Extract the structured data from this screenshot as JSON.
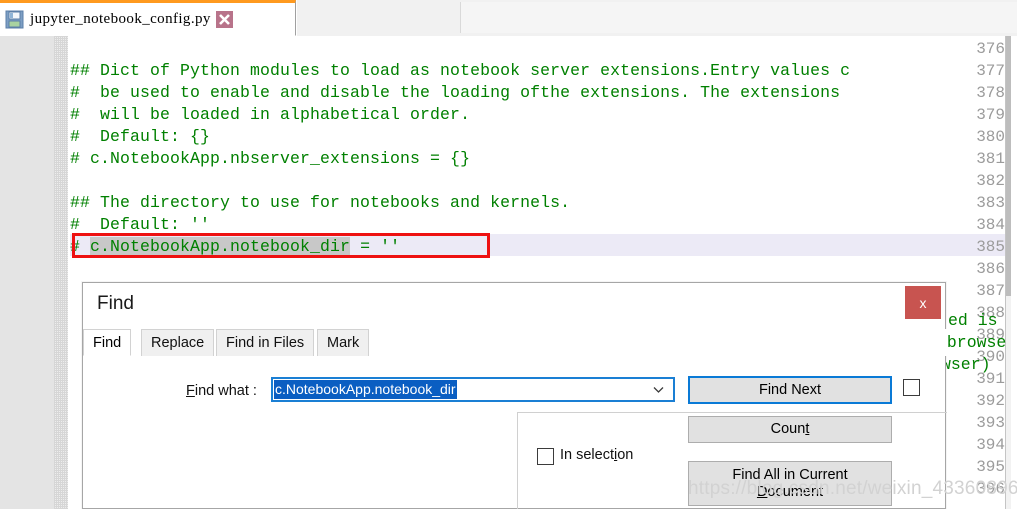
{
  "window": {
    "tab": {
      "title": "jupyter_notebook_config.py",
      "save_icon": "floppy-save-icon",
      "close_icon": "close-x-icon"
    }
  },
  "editor": {
    "first_line_number": 376,
    "current_line_number": 385,
    "lines": [
      {
        "no": "376",
        "text": ""
      },
      {
        "no": "377",
        "text": "## Dict of Python modules to load as notebook server extensions.Entry values c"
      },
      {
        "no": "378",
        "text": "#  be used to enable and disable the loading ofthe extensions. The extensions"
      },
      {
        "no": "379",
        "text": "#  will be loaded in alphabetical order."
      },
      {
        "no": "380",
        "text": "#  Default: {}"
      },
      {
        "no": "381",
        "text": "# c.NotebookApp.nbserver_extensions = {}"
      },
      {
        "no": "382",
        "text": ""
      },
      {
        "no": "383",
        "text": "## The directory to use for notebooks and kernels."
      },
      {
        "no": "384",
        "text": "#  Default: ''"
      },
      {
        "no": "385",
        "text": ""
      },
      {
        "no": "386",
        "text": ""
      },
      {
        "no": "387",
        "text": ""
      },
      {
        "no": "388",
        "text": ""
      },
      {
        "no": "389",
        "text": ""
      },
      {
        "no": "390",
        "text": ""
      },
      {
        "no": "391",
        "text": ""
      },
      {
        "no": "392",
        "text": ""
      },
      {
        "no": "393",
        "text": ""
      },
      {
        "no": "394",
        "text": ""
      },
      {
        "no": "395",
        "text": ""
      },
      {
        "no": "396",
        "text": ""
      }
    ],
    "highlighted_line": {
      "prefix": "# ",
      "match": "c.NotebookApp.notebook_dir",
      "suffix": " = ''"
    },
    "background_fragments": [
      {
        "text": "ed is"
      },
      {
        "text": "obrowse"
      },
      {
        "text": "wser)"
      }
    ]
  },
  "find_dialog": {
    "title": "Find",
    "close_label": "x",
    "tabs": [
      {
        "label": "Find",
        "active": true
      },
      {
        "label": "Replace",
        "active": false
      },
      {
        "label": "Find in Files",
        "active": false
      },
      {
        "label": "Mark",
        "active": false
      }
    ],
    "find_what": {
      "label_pre": "F",
      "label_post": "ind what :",
      "value": "c.NotebookApp.notebook_dir",
      "caret_icon": "chevron-down-icon"
    },
    "buttons": {
      "find_next": "Find Next",
      "count_pre": "Coun",
      "count_accel": "t",
      "count_post": "",
      "find_all_line1": "Find All in Current",
      "find_all_accel": "D",
      "find_all_line2": "ocument"
    },
    "checkboxes": {
      "top_right": {
        "label": "",
        "checked": false
      },
      "in_selection_pre": "In select",
      "in_selection_accel": "i",
      "in_selection_post": "on",
      "in_selection_checked": false
    }
  },
  "watermark": {
    "text": "https://blog.csdn.net/weixin_43360896"
  },
  "colors": {
    "tab_accent": "#ff9a1f",
    "code_green": "#008000",
    "annotation_red": "#ee1111",
    "selection_blue": "#0a5ec2",
    "default_button_border": "#0a7ad6",
    "close_red": "#c85450"
  }
}
